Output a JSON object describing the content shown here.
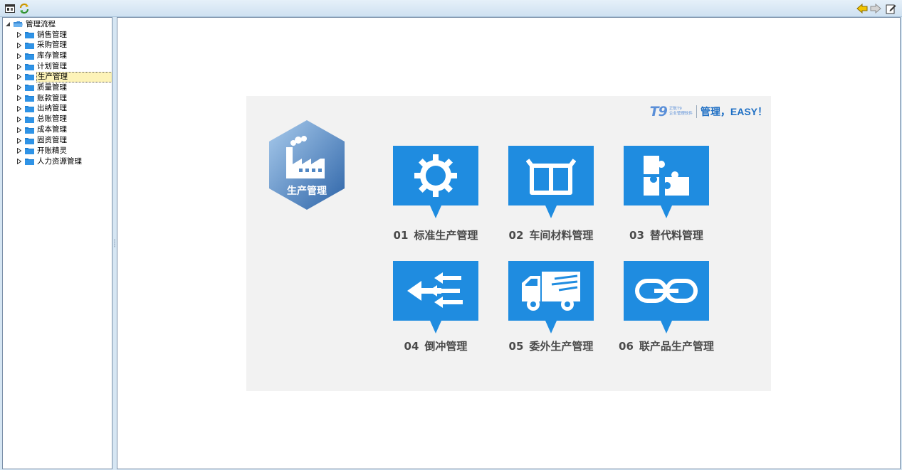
{
  "toolbar": {
    "left_icons": [
      "window-icon",
      "refresh-icon"
    ],
    "right_icons": [
      "back-arrow-icon",
      "forward-arrow-icon",
      "edit-icon"
    ]
  },
  "tree": {
    "root": "管理流程",
    "items": [
      {
        "label": "销售管理"
      },
      {
        "label": "采购管理"
      },
      {
        "label": "库存管理"
      },
      {
        "label": "计划管理"
      },
      {
        "label": "生产管理",
        "selected": true
      },
      {
        "label": "质量管理"
      },
      {
        "label": "账款管理"
      },
      {
        "label": "出纳管理"
      },
      {
        "label": "总账管理"
      },
      {
        "label": "成本管理"
      },
      {
        "label": "固资管理"
      },
      {
        "label": "开账精灵"
      },
      {
        "label": "人力资源管理"
      }
    ]
  },
  "banner": {
    "brand_logo": "T9",
    "brand_sub1": "正航T9",
    "brand_sub2": "企业管理软件",
    "slogan": "管理，EASY！",
    "module_title": "生产管理",
    "tiles": [
      {
        "num": "01",
        "label": "标准生产管理",
        "icon": "gear-icon"
      },
      {
        "num": "02",
        "label": "车间材料管理",
        "icon": "box-icon"
      },
      {
        "num": "03",
        "label": "替代料管理",
        "icon": "puzzle-icon"
      },
      {
        "num": "04",
        "label": "倒冲管理",
        "icon": "arrows-left-icon"
      },
      {
        "num": "05",
        "label": "委外生产管理",
        "icon": "truck-icon"
      },
      {
        "num": "06",
        "label": "联产品生产管理",
        "icon": "chain-link-icon"
      }
    ]
  },
  "colors": {
    "tile_blue": "#1f8ce0",
    "hex_dark": "#2e6aab",
    "hex_light": "#8fb8e2",
    "background": "#f2f2f2"
  }
}
